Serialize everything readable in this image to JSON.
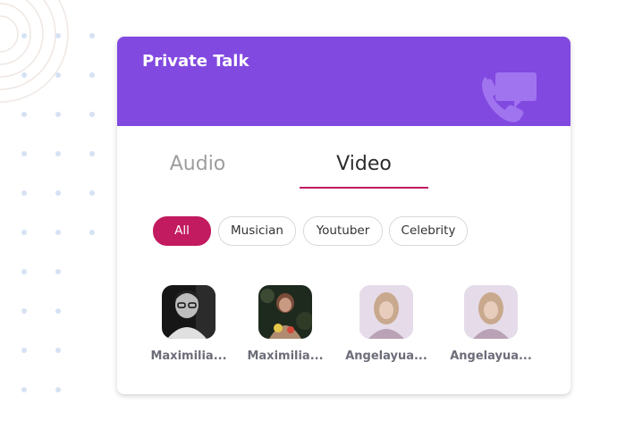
{
  "card": {
    "title": "Private Talk",
    "header_color": "#8149e0",
    "header_icon": "phone-message-icon"
  },
  "tabs": [
    {
      "label": "Audio",
      "active": false
    },
    {
      "label": "Video",
      "active": true
    }
  ],
  "filters": [
    {
      "label": "All",
      "active": true
    },
    {
      "label": "Musician",
      "active": false
    },
    {
      "label": "Youtuber",
      "active": false
    },
    {
      "label": "Celebrity",
      "active": false
    }
  ],
  "accent_color": "#c21b5f",
  "people": [
    {
      "name": "Maximilia..."
    },
    {
      "name": "Maximilia..."
    },
    {
      "name": "Angelayua..."
    },
    {
      "name": "Angelayua..."
    }
  ]
}
